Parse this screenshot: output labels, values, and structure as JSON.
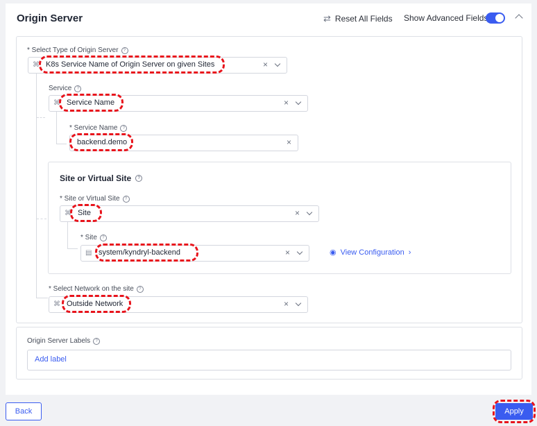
{
  "header": {
    "title": "Origin Server",
    "reset_label": "Reset All Fields",
    "advanced_label": "Show Advanced Fields",
    "advanced_enabled": true
  },
  "origin_type": {
    "label": "* Select Type of Origin Server",
    "value": "K8s Service Name of Origin Server on given Sites"
  },
  "service": {
    "label": "Service",
    "value": "Service Name",
    "name_label": "* Service Name",
    "name_value": "backend.demo"
  },
  "site_section": {
    "title": "Site or Virtual Site",
    "type_label": "* Site or Virtual Site",
    "type_value": "Site",
    "site_label": "* Site",
    "site_value": "system/kyndryl-backend",
    "view_config": "View Configuration"
  },
  "network": {
    "label": "* Select Network on the site",
    "value": "Outside Network"
  },
  "labels": {
    "title": "Origin Server Labels",
    "add_label": "Add label"
  },
  "footer": {
    "back": "Back",
    "apply": "Apply"
  },
  "colors": {
    "accent": "#3a5cf0",
    "highlight": "#e8141c"
  }
}
